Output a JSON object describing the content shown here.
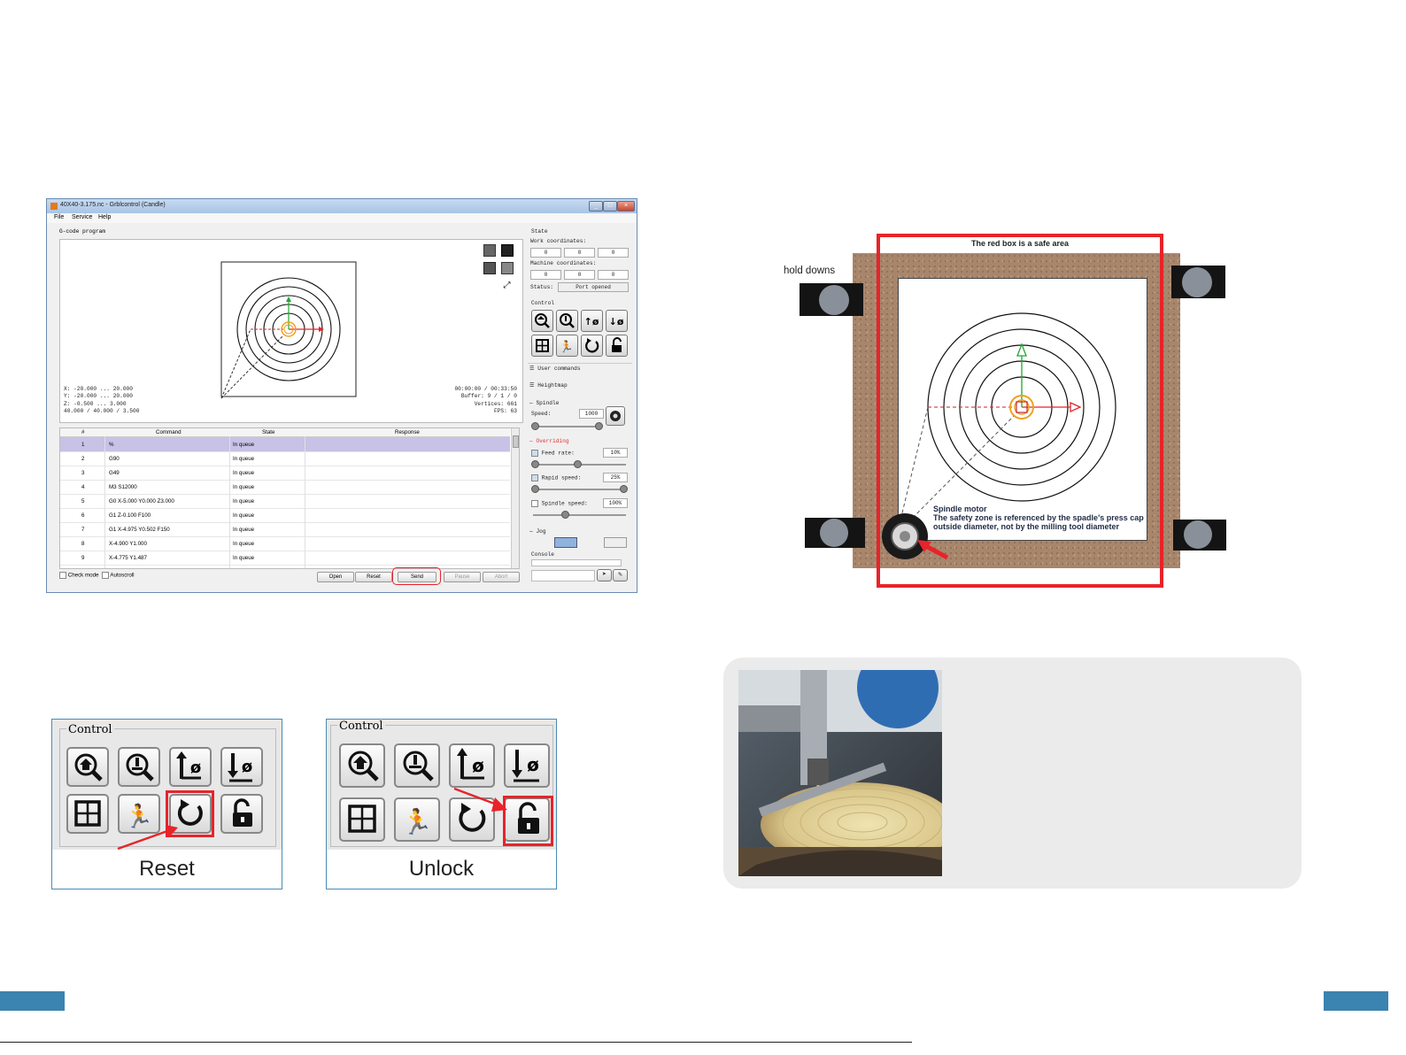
{
  "app": {
    "title": "40X40-3.175.nc - Grblcontrol  (Candle)",
    "window_buttons": [
      "_",
      "□",
      "×"
    ],
    "menu": [
      "File",
      "Service",
      "Help"
    ],
    "gcode_group": "G-code program",
    "viz_info_left": "X: -20.000 ... 20.000\nY: -20.000 ... 20.000\nZ: -0.500 ... 3.000\n40.000 / 40.000 / 3.500",
    "viz_info_right": "00:00:00 / 00:33:50\nBuffer: 9 / 1 / 0\nVertices: 661\nFPS: 63",
    "table": {
      "headers": [
        "#",
        "Command",
        "State",
        "Response"
      ],
      "rows": [
        {
          "n": "1",
          "cmd": "%",
          "state": "In queue"
        },
        {
          "n": "2",
          "cmd": "G90",
          "state": "In queue"
        },
        {
          "n": "3",
          "cmd": "G49",
          "state": "In queue"
        },
        {
          "n": "4",
          "cmd": "M3 S12000",
          "state": "In queue"
        },
        {
          "n": "5",
          "cmd": "G0 X-5.000 Y0.000 Z3.000",
          "state": "In queue"
        },
        {
          "n": "6",
          "cmd": "G1  Z-0.100 F100",
          "state": "In queue"
        },
        {
          "n": "7",
          "cmd": "G1 X-4.975 Y0.502  F150",
          "state": "In queue"
        },
        {
          "n": "8",
          "cmd": "X-4.900 Y1.000",
          "state": "In queue"
        },
        {
          "n": "9",
          "cmd": "X-4.775 Y1.487",
          "state": "In queue"
        }
      ]
    },
    "check_mode": "Check mode",
    "autoscroll": "Autoscroll",
    "buttons": {
      "open": "Open",
      "reset": "Reset",
      "send": "Send",
      "pause": "Pause",
      "abort": "Abort"
    },
    "side": {
      "state_title": "State",
      "work_coords_label": "Work coordinates:",
      "work_coords": [
        "0",
        "0",
        "0"
      ],
      "machine_coords_label": "Machine coordinates:",
      "machine_coords": [
        "0",
        "0",
        "0"
      ],
      "status_label": "Status:",
      "status_value": "Port opened",
      "control_title": "Control",
      "user_commands": "User commands",
      "heightmap": "Heightmap",
      "spindle": "Spindle",
      "speed_label": "Speed:",
      "speed_value": "1000",
      "overriding": "Overriding",
      "feed_rate_label": "Feed rate:",
      "feed_rate_value": "10%",
      "rapid_speed_label": "Rapid speed:",
      "rapid_speed_value": "25%",
      "spindle_speed_label": "Spindle speed:",
      "spindle_speed_value": "100%",
      "jog": "Jog",
      "console": "Console"
    }
  },
  "control_reset": {
    "title": "Control",
    "caption": "Reset"
  },
  "control_unlock": {
    "title": "Control",
    "caption": "Unlock"
  },
  "diagram": {
    "safe_area_label": "The red box is a safe area",
    "hold_downs_label": "hold downs",
    "spindle_title": "Spindle motor",
    "spindle_note_1": "The safety zone is referenced by the spadle's press cap",
    "spindle_note_2": "outside diameter, not by the milling tool diameter",
    "colors": {
      "safe_box": "#e8232a",
      "board": "#a8866c",
      "axis_x": "#e8232a",
      "axis_y": "#21a632"
    }
  },
  "photo": {
    "subject": "milling-wood-photo"
  },
  "footer": {
    "tab_color": "#3b83b0"
  }
}
